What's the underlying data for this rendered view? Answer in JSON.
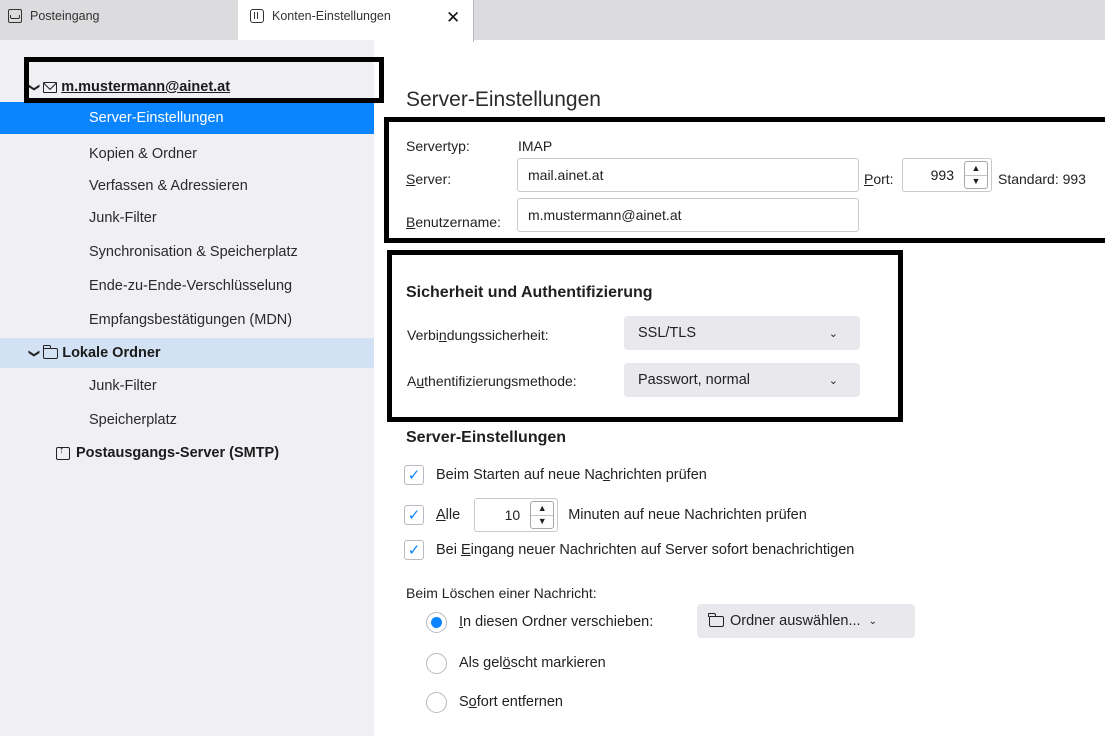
{
  "tabs": [
    {
      "label": "Posteingang",
      "icon": "inbox-icon"
    },
    {
      "label": "Konten-Einstellungen",
      "icon": "settings-page-icon",
      "close": "✕"
    }
  ],
  "sidebar": {
    "accounts": [
      {
        "label": "m.mustermann@ainet.at",
        "chevron": "❯",
        "icon": "envelope-icon"
      },
      {
        "label": "Lokale Ordner",
        "chevron": "❯",
        "icon": "folder-icon"
      },
      {
        "label": "Postausgangs-Server (SMTP)",
        "icon": "outbox-icon"
      }
    ],
    "account1_items": [
      "Server-Einstellungen",
      "Kopien & Ordner",
      "Verfassen & Adressieren",
      "Junk-Filter",
      "Synchronisation & Speicherplatz",
      "Ende-zu-Ende-Verschlüsselung",
      "Empfangsbestätigungen (MDN)"
    ],
    "account2_items": [
      "Junk-Filter",
      "Speicherplatz"
    ],
    "selected": "Server-Einstellungen"
  },
  "main": {
    "title": "Server-Einstellungen",
    "servertype_label": "Servertyp:",
    "servertype_value": "IMAP",
    "server_label_u": "S",
    "server_label_rest": "erver:",
    "server_value": "mail.ainet.at",
    "port_label_u": "P",
    "port_label_rest": "ort:",
    "port_value": "993",
    "standard_text": "Standard: 993",
    "username_label_u": "B",
    "username_label_rest": "enutzername:",
    "username_value": "m.mustermann@ainet.at",
    "security": {
      "title": "Sicherheit und Authentifizierung",
      "conn_label_a": "Verbi",
      "conn_label_u": "n",
      "conn_label_b": "dungssicherheit:",
      "conn_value": "SSL/TLS",
      "auth_label_a": "A",
      "auth_label_u": "u",
      "auth_label_b": "thentifizierungsmethode:",
      "auth_value": "Passwort, normal",
      "caret": "⌄"
    },
    "server_settings": {
      "title": "Server-Einstellungen",
      "check_startup_a": "Beim Starten auf neue Na",
      "check_startup_u": "c",
      "check_startup_b": "hrichten prüfen",
      "check_every_u": "A",
      "check_every_rest": "lle",
      "check_every_value": "10",
      "check_every_suffix": "Minuten auf neue Nachrichten prüfen",
      "check_notify_a": "Bei ",
      "check_notify_u": "E",
      "check_notify_b": "ingang neuer Nachrichten auf Server sofort benachrichtigen",
      "checkmark": "✓"
    },
    "delete": {
      "label": "Beim Löschen einer Nachricht:",
      "opt1_u": "I",
      "opt1_rest": "n diesen Ordner verschieben:",
      "folder_button": "Ordner auswählen...",
      "opt2_a": "Als gel",
      "opt2_u": "ö",
      "opt2_b": "scht markieren",
      "opt3_a": "S",
      "opt3_u": "o",
      "opt3_b": "fort entfernen",
      "selected_option": 1
    }
  },
  "colors": {
    "accent": "#0a84ff",
    "sidebar_bg": "#f0f0f4",
    "highlight_row": "#d2e1f3",
    "tabbar_bg": "#dcdcdf"
  }
}
